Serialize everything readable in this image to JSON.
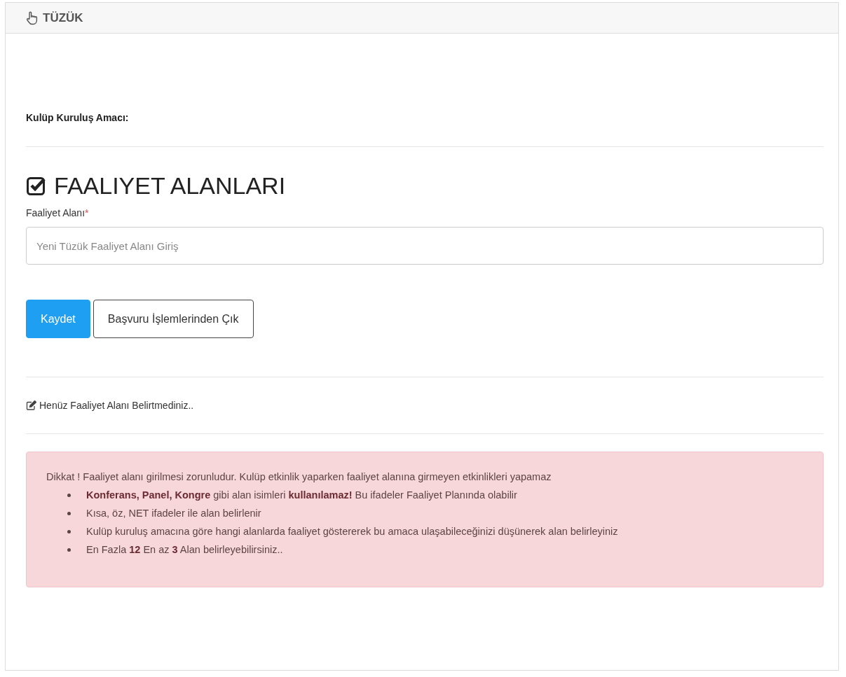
{
  "panel": {
    "title": "TÜZÜK"
  },
  "purpose_label": "Kulüp Kuruluş Amacı:",
  "section": {
    "title": "FAALIYET ALANLARI"
  },
  "field": {
    "label": "Faaliyet Alanı",
    "required_mark": "*",
    "placeholder": "Yeni Tüzük Faaliyet Alanı Giriş"
  },
  "buttons": [
    {
      "label": "Kaydet",
      "kind": "primary"
    },
    {
      "label": "Başvuru İşlemlerinden Çık",
      "kind": "outline"
    }
  ],
  "status_note": "Henüz Faaliyet Alanı Belirtmediniz..",
  "alert": {
    "text": "Dikkat ! Faaliyet alanı girilmesi zorunludur. Kulüp etkinlik yaparken faaliyet alanına girmeyen etkinlikleri yapamaz",
    "items": [
      "**Konferans, Panel, Kongre** gibi alan isimleri **kullanılamaz!** Bu ifadeler Faaliyet Planında olabilir",
      "Kısa, öz, NET ifadeler ile alan belirlenir",
      "Kulüp kuruluş amacına göre hangi alanlarda faaliyet göstererek bu amaca ulaşabileceğinizi düşünerek alan belirleyiniz",
      "En Fazla **12** En az **3** Alan belirleyebilirsiniz.."
    ]
  }
}
